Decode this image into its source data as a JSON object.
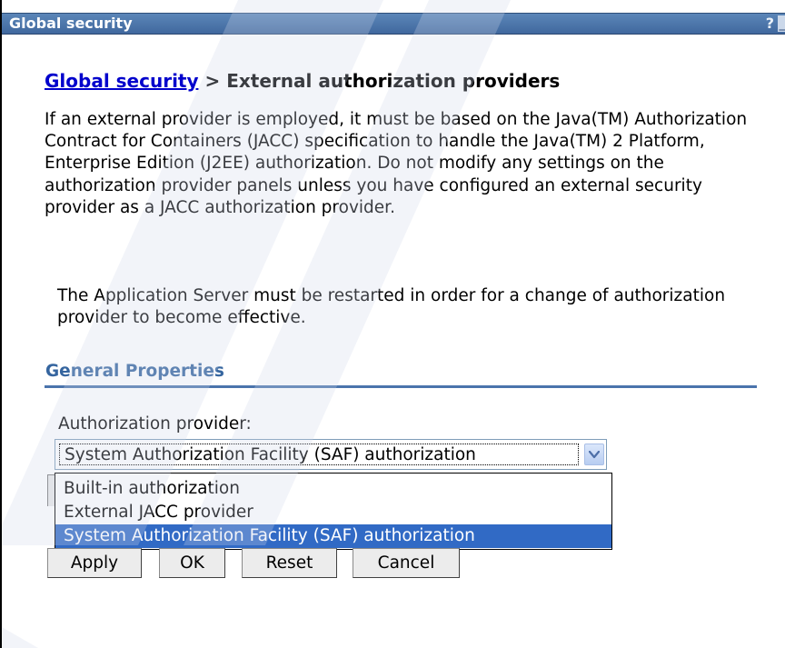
{
  "window": {
    "title": "Global security",
    "help_label": "?",
    "minimize_label": "_"
  },
  "breadcrumb": {
    "link": "Global security",
    "separator": " > ",
    "current": "External authorization providers"
  },
  "description": "If an external provider is employed, it must be based on the Java(TM) Authorization Contract for Containers (JACC) specification to handle the Java(TM) 2 Platform, Enterprise Edition (J2EE) authorization. Do not modify any settings on the authorization provider panels unless you have configured an external security provider as a JACC authorization provider.",
  "restart_note": "The Application Server must be restarted in order for a change of authorization provider to become effective.",
  "general_properties": {
    "heading": "General Properties",
    "field_label": "Authorization provider:",
    "selected_value": "System Authorization Facility (SAF) authorization",
    "options": [
      "Built-in authorization",
      "External JACC provider",
      "System Authorization Facility (SAF) authorization"
    ],
    "selected_index": 2
  },
  "buttons": {
    "apply": "Apply",
    "ok": "OK",
    "reset": "Reset",
    "cancel": "Cancel"
  },
  "colors": {
    "titlebar": "#4a74ac",
    "link": "#0000cc",
    "section_heading": "#35659f",
    "selected_option": "#316ac5"
  }
}
